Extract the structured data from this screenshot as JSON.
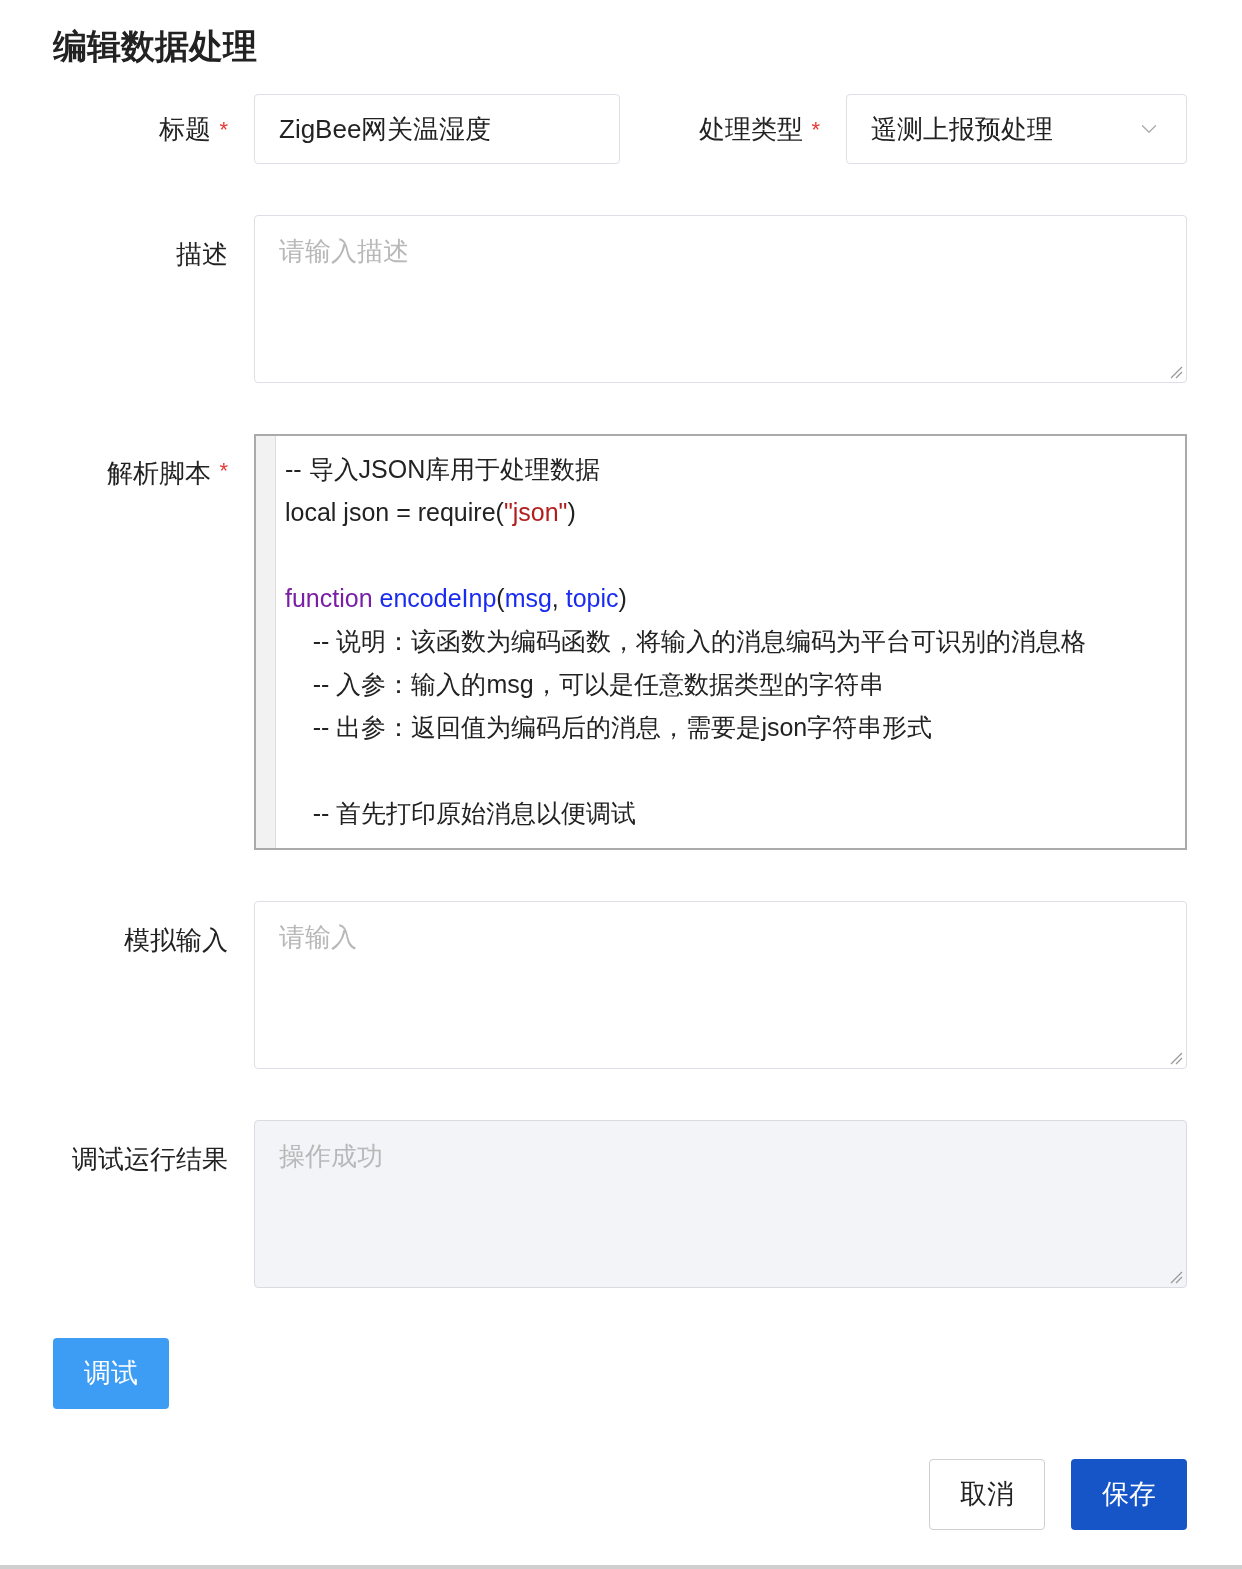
{
  "title": "编辑数据处理",
  "fields": {
    "name": {
      "label": "标题",
      "required": "*",
      "value": "ZigBee网关温湿度"
    },
    "type": {
      "label": "处理类型",
      "required": "*",
      "value": "遥测上报预处理"
    },
    "description": {
      "label": "描述",
      "placeholder": "请输入描述"
    },
    "script": {
      "label": "解析脚本",
      "required": "*",
      "lines": [
        {
          "kind": "code",
          "tokens": [
            {
              "kind": "comment",
              "text": "-- 导入JSON库用于处理数据"
            }
          ]
        },
        {
          "kind": "code",
          "tokens": [
            {
              "kind": "plain",
              "text": "local json = require("
            },
            {
              "kind": "string",
              "text": "\"json\""
            },
            {
              "kind": "plain",
              "text": ")"
            }
          ]
        },
        {
          "kind": "blank"
        },
        {
          "kind": "code",
          "tokens": [
            {
              "kind": "keyword",
              "text": "function "
            },
            {
              "kind": "def",
              "text": "encodeInp"
            },
            {
              "kind": "plain",
              "text": "("
            },
            {
              "kind": "def",
              "text": "msg"
            },
            {
              "kind": "plain",
              "text": ", "
            },
            {
              "kind": "def",
              "text": "topic"
            },
            {
              "kind": "plain",
              "text": ")"
            }
          ]
        },
        {
          "kind": "code",
          "tokens": [
            {
              "kind": "comment",
              "text": "    -- 说明：该函数为编码函数，将输入的消息编码为平台可识别的消息格"
            }
          ]
        },
        {
          "kind": "code",
          "tokens": [
            {
              "kind": "comment",
              "text": "    -- 入参：输入的msg，可以是任意数据类型的字符串"
            }
          ]
        },
        {
          "kind": "code",
          "tokens": [
            {
              "kind": "comment",
              "text": "    -- 出参：返回值为编码后的消息，需要是json字符串形式"
            }
          ]
        },
        {
          "kind": "blank"
        },
        {
          "kind": "code",
          "tokens": [
            {
              "kind": "comment",
              "text": "    -- 首先打印原始消息以便调试"
            }
          ]
        }
      ]
    },
    "mock_input": {
      "label": "模拟输入",
      "placeholder": "请输入"
    },
    "result": {
      "label": "调试运行结果",
      "placeholder": "操作成功",
      "disabled": true
    }
  },
  "debug_button": "调试",
  "footer_buttons": [
    {
      "label": "取消",
      "kind": "secondary"
    },
    {
      "label": "保存",
      "kind": "primary"
    }
  ]
}
